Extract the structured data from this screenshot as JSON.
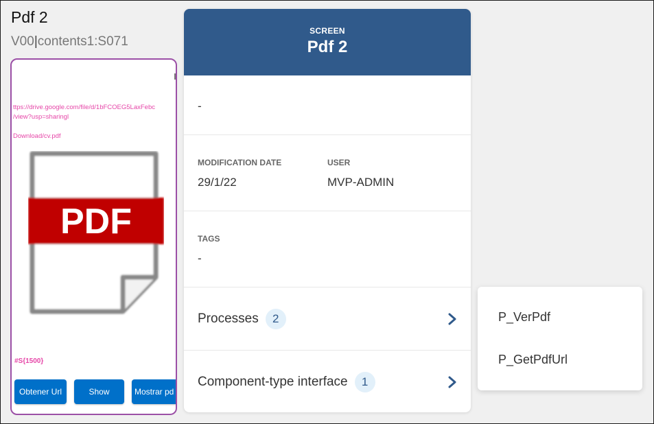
{
  "header": {
    "title": "Pdf 2",
    "version": "V00",
    "path": "contents1:S071"
  },
  "preview": {
    "url_line1": "ttps://drive.google.com/file/d/1bFCOEG5LaxFebc",
    "url_line2": "/view?usp=sharingl",
    "download": "Download/cv.pdf",
    "pdf_label": "PDF",
    "variable": "#S{1500}",
    "buttons": [
      "Obtener Url",
      "Show",
      "Mostrar pd"
    ],
    "pdf_red": "#c00000"
  },
  "card": {
    "type_label": "SCREEN",
    "name": "Pdf 2",
    "description": "-",
    "modification_date_label": "MODIFICATION DATE",
    "modification_date": "29/1/22",
    "user_label": "USER",
    "user": "MVP-ADMIN",
    "tags_label": "TAGS",
    "tags": "-",
    "processes_label": "Processes",
    "processes_count": "2",
    "component_label": "Component-type interface",
    "component_count": "1",
    "header_color": "#305a8b"
  },
  "popup": {
    "items": [
      "P_VerPdf",
      "P_GetPdfUrl"
    ]
  },
  "icons": {
    "chevron": "chevron-right-icon",
    "pdf": "pdf-file-icon"
  }
}
